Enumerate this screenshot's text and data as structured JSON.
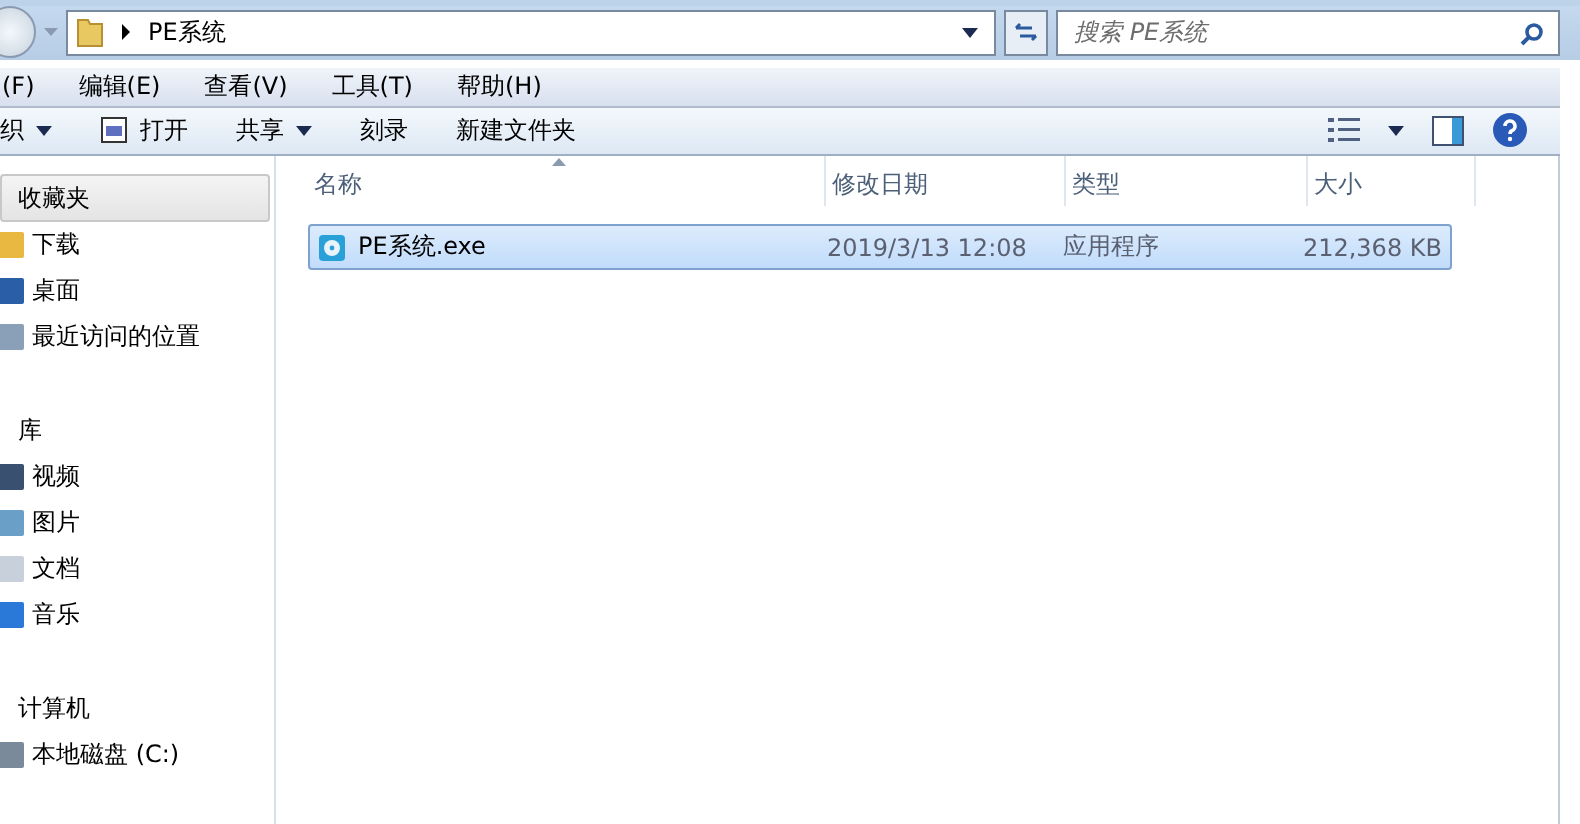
{
  "address_bar": {
    "path": "PE系统"
  },
  "search": {
    "placeholder": "搜索 PE系统"
  },
  "menu_bar": [
    "(F)",
    "编辑(E)",
    "查看(V)",
    "工具(T)",
    "帮助(H)"
  ],
  "toolbar": [
    {
      "label": "织",
      "kind": "dropdown"
    },
    {
      "label": "打开",
      "kind": "icon"
    },
    {
      "label": "共享",
      "kind": "dropdown"
    },
    {
      "label": "刻录",
      "kind": "plain"
    },
    {
      "label": "新建文件夹",
      "kind": "plain"
    }
  ],
  "sidebar": {
    "groups": [
      {
        "label": "收藏夹",
        "selected": true,
        "children": [
          {
            "label": "下载",
            "kind": "download"
          },
          {
            "label": "桌面",
            "kind": "desktop"
          },
          {
            "label": "最近访问的位置",
            "kind": "recent"
          }
        ]
      },
      {
        "label": "库",
        "selected": false,
        "children": [
          {
            "label": "视频",
            "kind": "video"
          },
          {
            "label": "图片",
            "kind": "picture"
          },
          {
            "label": "文档",
            "kind": "document"
          },
          {
            "label": "音乐",
            "kind": "music"
          }
        ]
      },
      {
        "label": "计算机",
        "selected": false,
        "children": [
          {
            "label": "本地磁盘 (C:)",
            "kind": "drive"
          }
        ]
      }
    ]
  },
  "table": {
    "columns": [
      "名称",
      "修改日期",
      "类型",
      "大小"
    ],
    "rows": [
      {
        "cells": [
          "PE系统.exe",
          "2019/3/13 12:08",
          "应用程序",
          "212,368 KB"
        ],
        "selected": true
      }
    ]
  }
}
